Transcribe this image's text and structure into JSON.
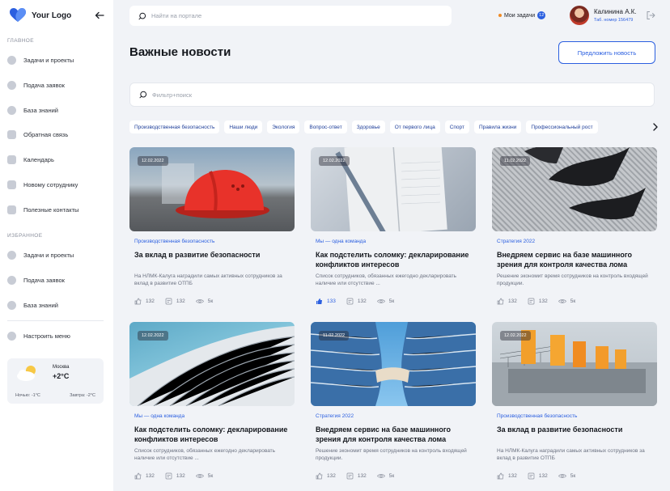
{
  "logo": {
    "text": "Your Logo"
  },
  "sidebar": {
    "main_label": "ГЛАВНОЕ",
    "items": [
      {
        "label": "Задачи и проекты",
        "icon": "tasks-icon"
      },
      {
        "label": "Подача заявок",
        "icon": "users-icon"
      },
      {
        "label": "База знаний",
        "icon": "info-icon"
      },
      {
        "label": "Обратная связь",
        "icon": "feedback-icon"
      },
      {
        "label": "Календарь",
        "icon": "calendar-icon"
      },
      {
        "label": "Новому сотруднику",
        "icon": "document-icon"
      },
      {
        "label": "Полезные контакты",
        "icon": "contacts-icon"
      }
    ],
    "favorites_label": "ИЗБРАННОЕ",
    "favorites": [
      {
        "label": "Задачи и проекты",
        "icon": "tasks-icon"
      },
      {
        "label": "Подача заявок",
        "icon": "users-icon"
      },
      {
        "label": "База знаний",
        "icon": "info-icon"
      }
    ],
    "settings_label": "Настроить меню"
  },
  "weather": {
    "city": "Москва",
    "temp": "+2°C",
    "night": "Ночью: -1°C",
    "tomorrow": "Завтра: -2°C"
  },
  "header": {
    "search_placeholder": "Найти на портале",
    "tasks_label": "Мои задачи",
    "tasks_count": "12",
    "user_name": "Калинина А.К.",
    "user_id": "Таб. номер 156479"
  },
  "page": {
    "title": "Важные новости",
    "propose_label": "Предложить новость",
    "filter_placeholder": "Фильтр+поиск"
  },
  "chips": [
    "Производственная безопасность",
    "Наши люди",
    "Экология",
    "Вопрос-ответ",
    "Здоровье",
    "От первого лица",
    "Спорт",
    "Правила жизни",
    "Профессиональный рост"
  ],
  "cards": [
    {
      "date": "12.02.2022",
      "category": "Производственная безопасность",
      "title": "За вклад в развитие безопасности",
      "desc": "На НЛМК-Калуга наградили самых активных сотрудников за вклад в развитие ОТПБ",
      "likes": "132",
      "comments": "132",
      "views": "5к",
      "liked": false
    },
    {
      "date": "12.02.2022",
      "category": "Мы — одна команда",
      "title": "Как подстелить соломку: декларирование конфликтов интересов",
      "desc": "Список сотрудников, обязанных ежегодно декларировать наличие или отсутствие ...",
      "likes": "133",
      "comments": "132",
      "views": "5к",
      "liked": true
    },
    {
      "date": "11.02.2022",
      "category": "Стратегия 2022",
      "title": "Внедряем сервис на базе машинного зрения для контроля качества лома",
      "desc": "Решение экономит время сотрудников на контроль входящей продукции.",
      "likes": "132",
      "comments": "132",
      "views": "5к",
      "liked": false
    },
    {
      "date": "12.02.2022",
      "category": "Мы — одна команда",
      "title": "Как подстелить соломку: декларирование конфликтов интересов",
      "desc": "Список сотрудников, обязанных ежегодно декларировать наличие или отсутствие ...",
      "likes": "132",
      "comments": "132",
      "views": "5к",
      "liked": false
    },
    {
      "date": "11.02.2022",
      "category": "Стратегия 2022",
      "title": "Внедряем сервис на базе машинного зрения для контроля качества лома",
      "desc": "Решение экономит время сотрудников на контроль входящей продукции.",
      "likes": "132",
      "comments": "132",
      "views": "5к",
      "liked": false
    },
    {
      "date": "12.02.2022",
      "category": "Производственная безопасность",
      "title": "За вклад в развитие безопасности",
      "desc": "На НЛМК-Калуга наградили самых активных сотрудников за вклад в развитие ОТПБ",
      "likes": "132",
      "comments": "132",
      "views": "5к",
      "liked": false
    }
  ],
  "colors": {
    "accent": "#2b5fe0",
    "tasks_dot": "#f08a24",
    "background": "#f1f3f7"
  }
}
